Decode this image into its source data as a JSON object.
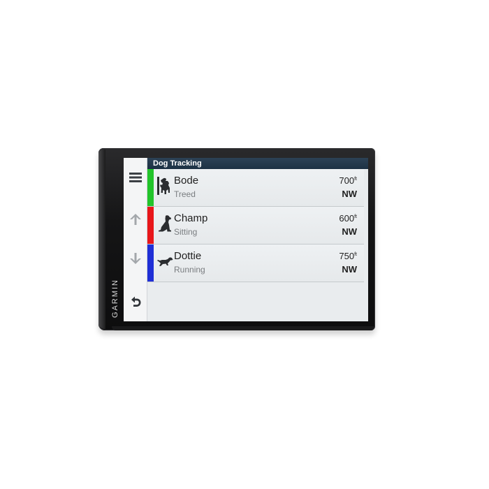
{
  "device": {
    "brand": "GARMIN"
  },
  "header": {
    "title": "Dog Tracking"
  },
  "sidebar": {
    "items": [
      {
        "icon": "menu-icon"
      },
      {
        "icon": "arrow-up-icon"
      },
      {
        "icon": "arrow-down-icon"
      },
      {
        "icon": "back-icon"
      }
    ]
  },
  "dogs": [
    {
      "name": "Bode",
      "status": "Treed",
      "distance": "700",
      "unit": "ft",
      "direction": "NW",
      "color": "#22c42a",
      "icon": "dog-treed-icon"
    },
    {
      "name": "Champ",
      "status": "Sitting",
      "distance": "600",
      "unit": "ft",
      "direction": "NW",
      "color": "#e8161a",
      "icon": "dog-sitting-icon"
    },
    {
      "name": "Dottie",
      "status": "Running",
      "distance": "750",
      "unit": "ft",
      "direction": "NW",
      "color": "#1f2fd6",
      "icon": "dog-running-icon"
    }
  ]
}
